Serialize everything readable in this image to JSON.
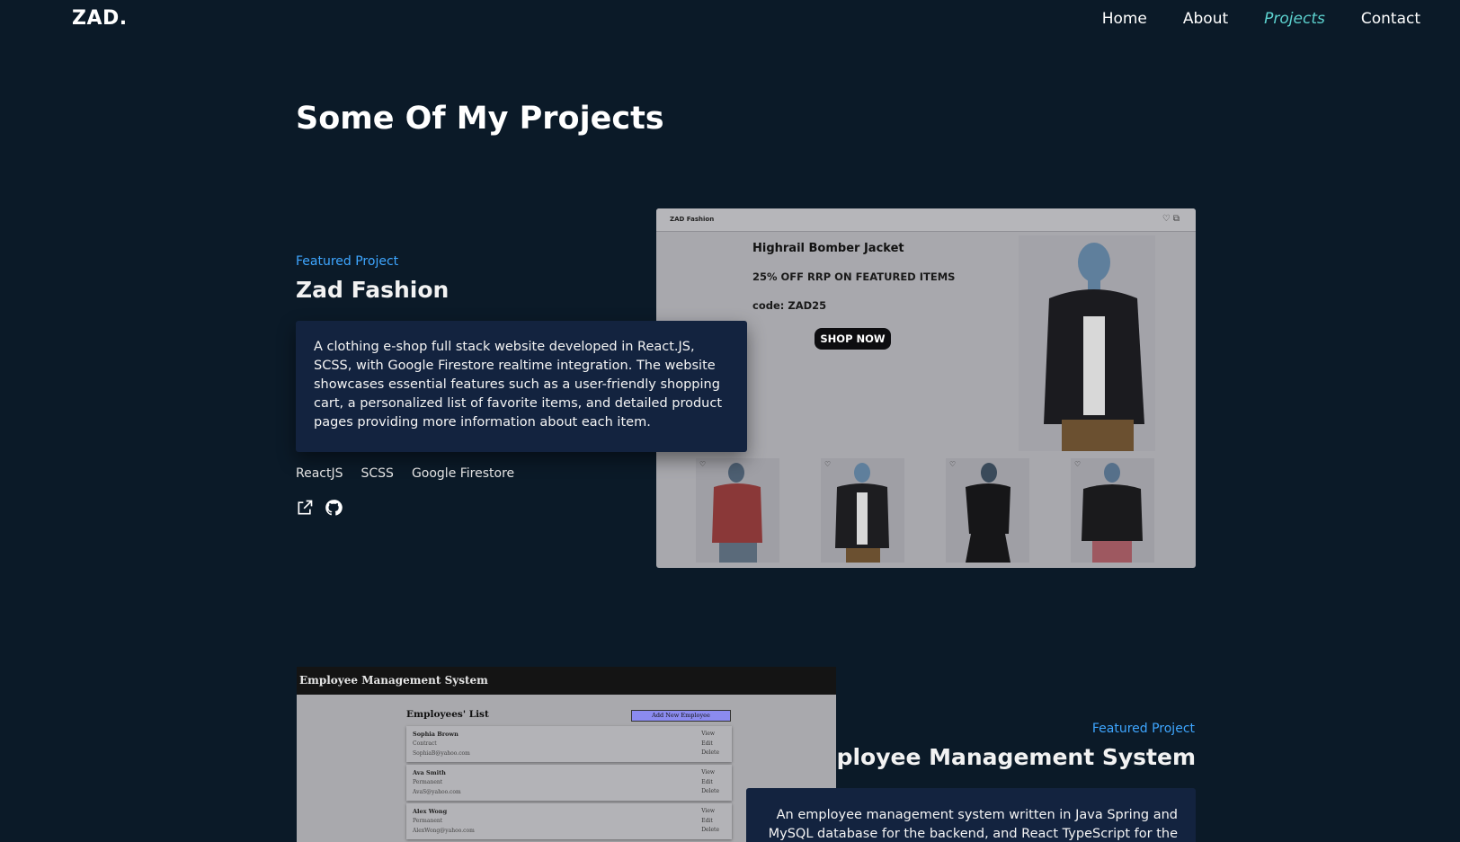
{
  "nav": {
    "logo": "ZAD.",
    "links": [
      {
        "label": "Home",
        "active": false
      },
      {
        "label": "About",
        "active": false
      },
      {
        "label": "Projects",
        "active": true
      },
      {
        "label": "Contact",
        "active": false
      }
    ]
  },
  "section": {
    "title": "Some Of My Projects"
  },
  "projects": [
    {
      "overline": "Featured Project",
      "title": "Zad Fashion",
      "description": "A clothing e-shop full stack website developed in React.JS, SCSS, with Google Firestore realtime integration. The website showcases essential features such as a user-friendly shopping cart, a personalized list of favorite items, and detailed product pages providing more information about each item.",
      "tags": [
        "ReactJS",
        "SCSS",
        "Google Firestore"
      ],
      "links": [
        "external-link-icon",
        "github-icon"
      ],
      "preview": {
        "brand": "ZAD Fashion",
        "hero_title": "Highrail Bomber Jacket",
        "hero_offer": "25% OFF RRP ON FEATURED ITEMS",
        "hero_code": "code: ZAD25",
        "shop_button": "SHOP NOW"
      }
    },
    {
      "overline": "Featured Project",
      "title": "Employee Management System",
      "description": "An employee management system written in Java Spring and MySQL database for the backend, and React TypeScript for the",
      "preview": {
        "app_title": "Employee Management System",
        "list_title": "Employees' List",
        "add_button": "Add New Employee",
        "employees": [
          {
            "name": "Sophia Brown",
            "type": "Contract",
            "email": "SophiaB@yahoo.com"
          },
          {
            "name": "Ava Smith",
            "type": "Permanent",
            "email": "AvaS@yahoo.com"
          },
          {
            "name": "Alex Wong",
            "type": "Permanent",
            "email": "AlexWong@yahoo.com"
          }
        ],
        "actions": [
          "View",
          "Edit",
          "Delete"
        ]
      }
    }
  ],
  "colors": {
    "background": "#0b1a28",
    "accent_active": "#5dd3d0",
    "overline": "#3ea6ff",
    "card": "#13233f"
  }
}
